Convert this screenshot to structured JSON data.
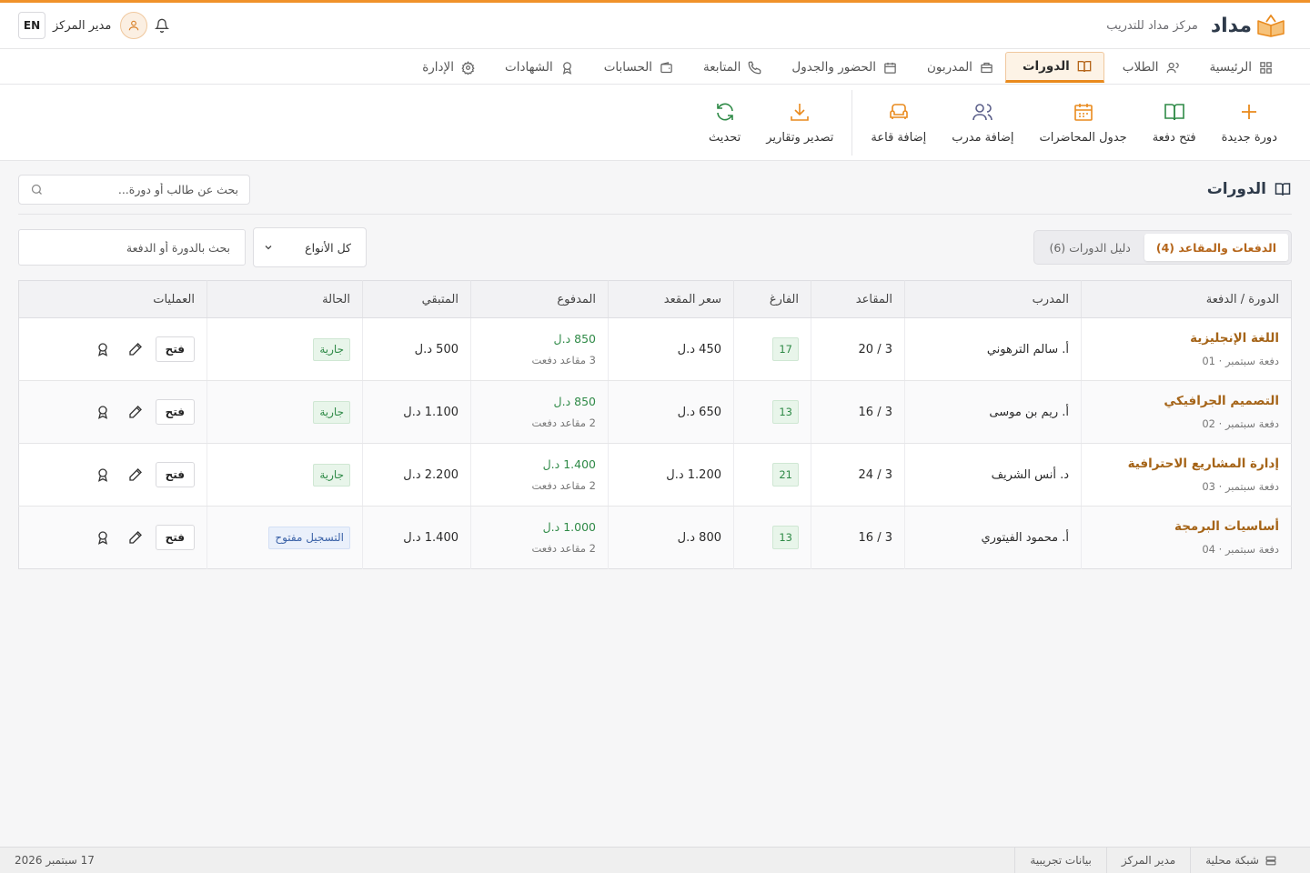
{
  "app": {
    "logo_text_main": "مداد",
    "center_name": "مركز مداد للتدريب",
    "user_name": "مدير المركز",
    "lang_label": "EN",
    "accent_color": "#e98a1d"
  },
  "nav": {
    "items": [
      {
        "label": "الرئيسية",
        "icon": "grid-icon"
      },
      {
        "label": "الطلاب",
        "icon": "user-icon"
      },
      {
        "label": "الدورات",
        "icon": "book-icon",
        "active": true
      },
      {
        "label": "المدربون",
        "icon": "briefcase-icon"
      },
      {
        "label": "الحضور والجدول",
        "icon": "calendar-icon"
      },
      {
        "label": "المتابعة",
        "icon": "phone-icon"
      },
      {
        "label": "الحسابات",
        "icon": "wallet-icon"
      },
      {
        "label": "الشهادات",
        "icon": "award-icon"
      },
      {
        "label": "الإدارة",
        "icon": "gear-icon"
      }
    ]
  },
  "ribbon": {
    "new_course": "دورة جديدة",
    "open_batch": "فتح دفعة",
    "schedule": "جدول المحاضرات",
    "add_trainer": "إضافة مدرب",
    "add_room": "إضافة قاعة",
    "export": "تصدير وتقارير",
    "refresh": "تحديث"
  },
  "page": {
    "title": "الدورات",
    "search_placeholder": "بحث عن طالب أو دورة..."
  },
  "tabs": {
    "batches": "الدفعات والمقاعد (4)",
    "directory": "دليل الدورات (6)"
  },
  "filters": {
    "type_selected": "كل الأنواع",
    "search_placeholder": "بحث بالدورة أو الدفعة"
  },
  "table": {
    "headers": {
      "course": "الدورة / الدفعة",
      "trainer": "المدرب",
      "seats": "المقاعد",
      "free": "الفارغ",
      "price": "سعر المقعد",
      "paid": "المدفوع",
      "remaining": "المتبقي",
      "status": "الحالة",
      "ops": "العمليات"
    },
    "open_label": "فتح",
    "rows": [
      {
        "course": "اللغة الإنجليزية",
        "batch": "دفعة سبتمبر · 01",
        "trainer": "أ. سالم الترهوني",
        "seats": "3 / 20",
        "free": "17",
        "price": "450 د.ل",
        "paid": "850 د.ل",
        "paid_sub": "3 مقاعد دفعت",
        "remaining": "500 د.ل",
        "status": "جارية",
        "status_type": "running"
      },
      {
        "course": "التصميم الجرافيكي",
        "batch": "دفعة سبتمبر · 02",
        "trainer": "أ. ريم بن موسى",
        "seats": "3 / 16",
        "free": "13",
        "price": "650 د.ل",
        "paid": "850 د.ل",
        "paid_sub": "2 مقاعد دفعت",
        "remaining": "1.100 د.ل",
        "status": "جارية",
        "status_type": "running"
      },
      {
        "course": "إدارة المشاريع الاحترافية",
        "batch": "دفعة سبتمبر · 03",
        "trainer": "د. أنس الشريف",
        "seats": "3 / 24",
        "free": "21",
        "price": "1.200 د.ل",
        "paid": "1.400 د.ل",
        "paid_sub": "2 مقاعد دفعت",
        "remaining": "2.200 د.ل",
        "status": "جارية",
        "status_type": "running"
      },
      {
        "course": "أساسيات البرمجة",
        "batch": "دفعة سبتمبر · 04",
        "trainer": "أ. محمود الفيتوري",
        "seats": "3 / 16",
        "free": "13",
        "price": "800 د.ل",
        "paid": "1.000 د.ل",
        "paid_sub": "2 مقاعد دفعت",
        "remaining": "1.400 د.ل",
        "status": "التسجيل مفتوح",
        "status_type": "open"
      }
    ]
  },
  "statusbar": {
    "network": "شبكة محلية",
    "role": "مدير المركز",
    "data_mode": "بيانات تجريبية",
    "date": "17 سبتمبر 2026"
  }
}
